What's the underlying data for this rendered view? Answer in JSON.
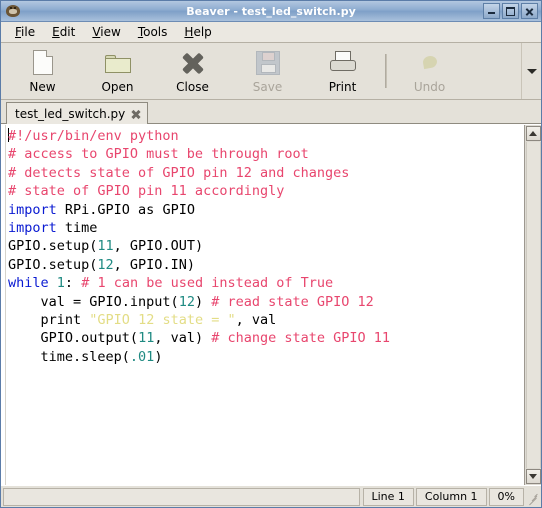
{
  "window": {
    "title": "Beaver - test_led_switch.py",
    "app_icon": "beaver-icon",
    "controls": {
      "minimize": "minimize-icon",
      "maximize": "maximize-icon",
      "close": "close-icon"
    }
  },
  "menubar": {
    "items": [
      {
        "label": "File",
        "mnemonic": "F"
      },
      {
        "label": "Edit",
        "mnemonic": "E"
      },
      {
        "label": "View",
        "mnemonic": "V"
      },
      {
        "label": "Tools",
        "mnemonic": "T"
      },
      {
        "label": "Help",
        "mnemonic": "H"
      }
    ]
  },
  "toolbar": {
    "items": [
      {
        "label": "New",
        "icon": "new-document-icon",
        "enabled": true
      },
      {
        "label": "Open",
        "icon": "open-folder-icon",
        "enabled": true
      },
      {
        "label": "Close",
        "icon": "close-x-icon",
        "enabled": true
      },
      {
        "label": "Save",
        "icon": "save-floppy-icon",
        "enabled": false
      },
      {
        "label": "Print",
        "icon": "printer-icon",
        "enabled": true
      },
      {
        "label": "Undo",
        "icon": "undo-arrow-icon",
        "enabled": false
      }
    ],
    "overflow_icon": "chevron-down-icon"
  },
  "tabs": [
    {
      "label": "test_led_switch.py",
      "active": true,
      "close_icon": "tab-close-icon"
    }
  ],
  "editor": {
    "lines": [
      [
        {
          "t": "#!/usr/bin/env python",
          "c": "comment"
        }
      ],
      [
        {
          "t": "# access to GPIO must be through root",
          "c": "comment"
        }
      ],
      [
        {
          "t": "# detects state of GPIO pin 12 and changes",
          "c": "comment"
        }
      ],
      [
        {
          "t": "# state of GPIO pin 11 accordingly",
          "c": "comment"
        }
      ],
      [
        {
          "t": "import",
          "c": "kw"
        },
        {
          "t": " RPi.GPIO as GPIO",
          "c": "plain"
        }
      ],
      [
        {
          "t": "import",
          "c": "kw"
        },
        {
          "t": " time",
          "c": "plain"
        }
      ],
      [
        {
          "t": "GPIO.setup(",
          "c": "plain"
        },
        {
          "t": "11",
          "c": "num"
        },
        {
          "t": ", GPIO.OUT)",
          "c": "plain"
        }
      ],
      [
        {
          "t": "GPIO.setup(",
          "c": "plain"
        },
        {
          "t": "12",
          "c": "num"
        },
        {
          "t": ", GPIO.IN)",
          "c": "plain"
        }
      ],
      [
        {
          "t": "while",
          "c": "kw"
        },
        {
          "t": " ",
          "c": "plain"
        },
        {
          "t": "1",
          "c": "num"
        },
        {
          "t": ": ",
          "c": "plain"
        },
        {
          "t": "# 1 can be used instead of True",
          "c": "comment"
        }
      ],
      [
        {
          "t": "    val = GPIO.input(",
          "c": "plain"
        },
        {
          "t": "12",
          "c": "num"
        },
        {
          "t": ") ",
          "c": "plain"
        },
        {
          "t": "# read state GPIO 12",
          "c": "comment"
        }
      ],
      [
        {
          "t": "    print ",
          "c": "plain"
        },
        {
          "t": "\"GPIO 12 state = \"",
          "c": "str"
        },
        {
          "t": ", val",
          "c": "plain"
        }
      ],
      [
        {
          "t": "    GPIO.output(",
          "c": "plain"
        },
        {
          "t": "11",
          "c": "num"
        },
        {
          "t": ", val) ",
          "c": "plain"
        },
        {
          "t": "# change state GPIO 11",
          "c": "comment"
        }
      ],
      [
        {
          "t": "    time.sleep(",
          "c": "plain"
        },
        {
          "t": ".01",
          "c": "num"
        },
        {
          "t": ")",
          "c": "plain"
        }
      ]
    ],
    "scrollbar": {
      "up_icon": "scroll-up-icon",
      "down_icon": "scroll-down-icon"
    }
  },
  "statusbar": {
    "line": "Line 1",
    "column": "Column 1",
    "progress": "0%",
    "grip": "resize-grip-icon"
  },
  "colors": {
    "titlebar_accent": "#8fadd0",
    "comment": "#e8466e",
    "keyword": "#0a1ad2",
    "number": "#1f8a82",
    "string": "#e3dd86",
    "chrome": "#e4e1d9"
  }
}
